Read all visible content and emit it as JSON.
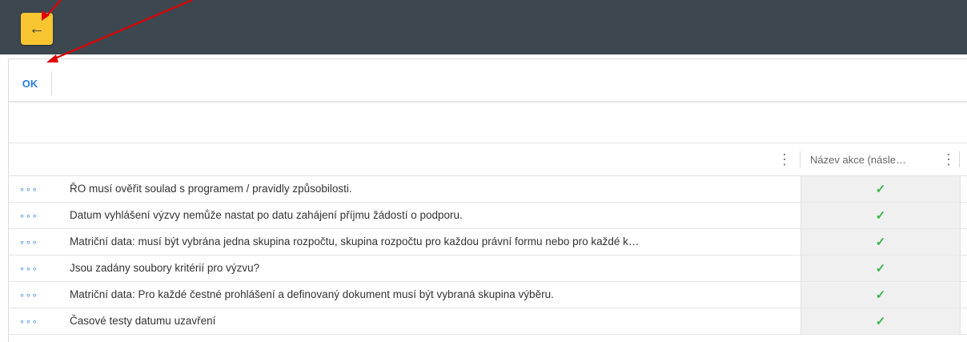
{
  "header": {
    "back_icon": "←"
  },
  "toolbar": {
    "ok_label": "OK"
  },
  "grid": {
    "column_menu_icon": "⋮",
    "column_title": "Název akce (násle…",
    "row_menu_icon": "∘∘∘",
    "check_icon": "✓",
    "rows": [
      {
        "text": "ŘO musí ověřit soulad s programem / pravidly způsobilosti."
      },
      {
        "text": "Datum vyhlášení výzvy nemůže nastat po datu zahájení příjmu žádostí o podporu."
      },
      {
        "text": "Matriční data: musí být vybrána jedna skupina rozpočtu, skupina rozpočtu pro každou právní formu nebo pro každé k…"
      },
      {
        "text": "Jsou zadány soubory kritérií pro výzvu?"
      },
      {
        "text": "Matriční data: Pro každé čestné prohlášení a definovaný dokument musí být vybraná skupina výběru."
      },
      {
        "text": "Časové testy datumu uzavření"
      }
    ]
  },
  "colors": {
    "topbar": "#3c4750",
    "back_button": "#f9c632",
    "accent_blue": "#2a7de1",
    "check_green": "#39b54a",
    "annotation_red": "#e00000"
  }
}
